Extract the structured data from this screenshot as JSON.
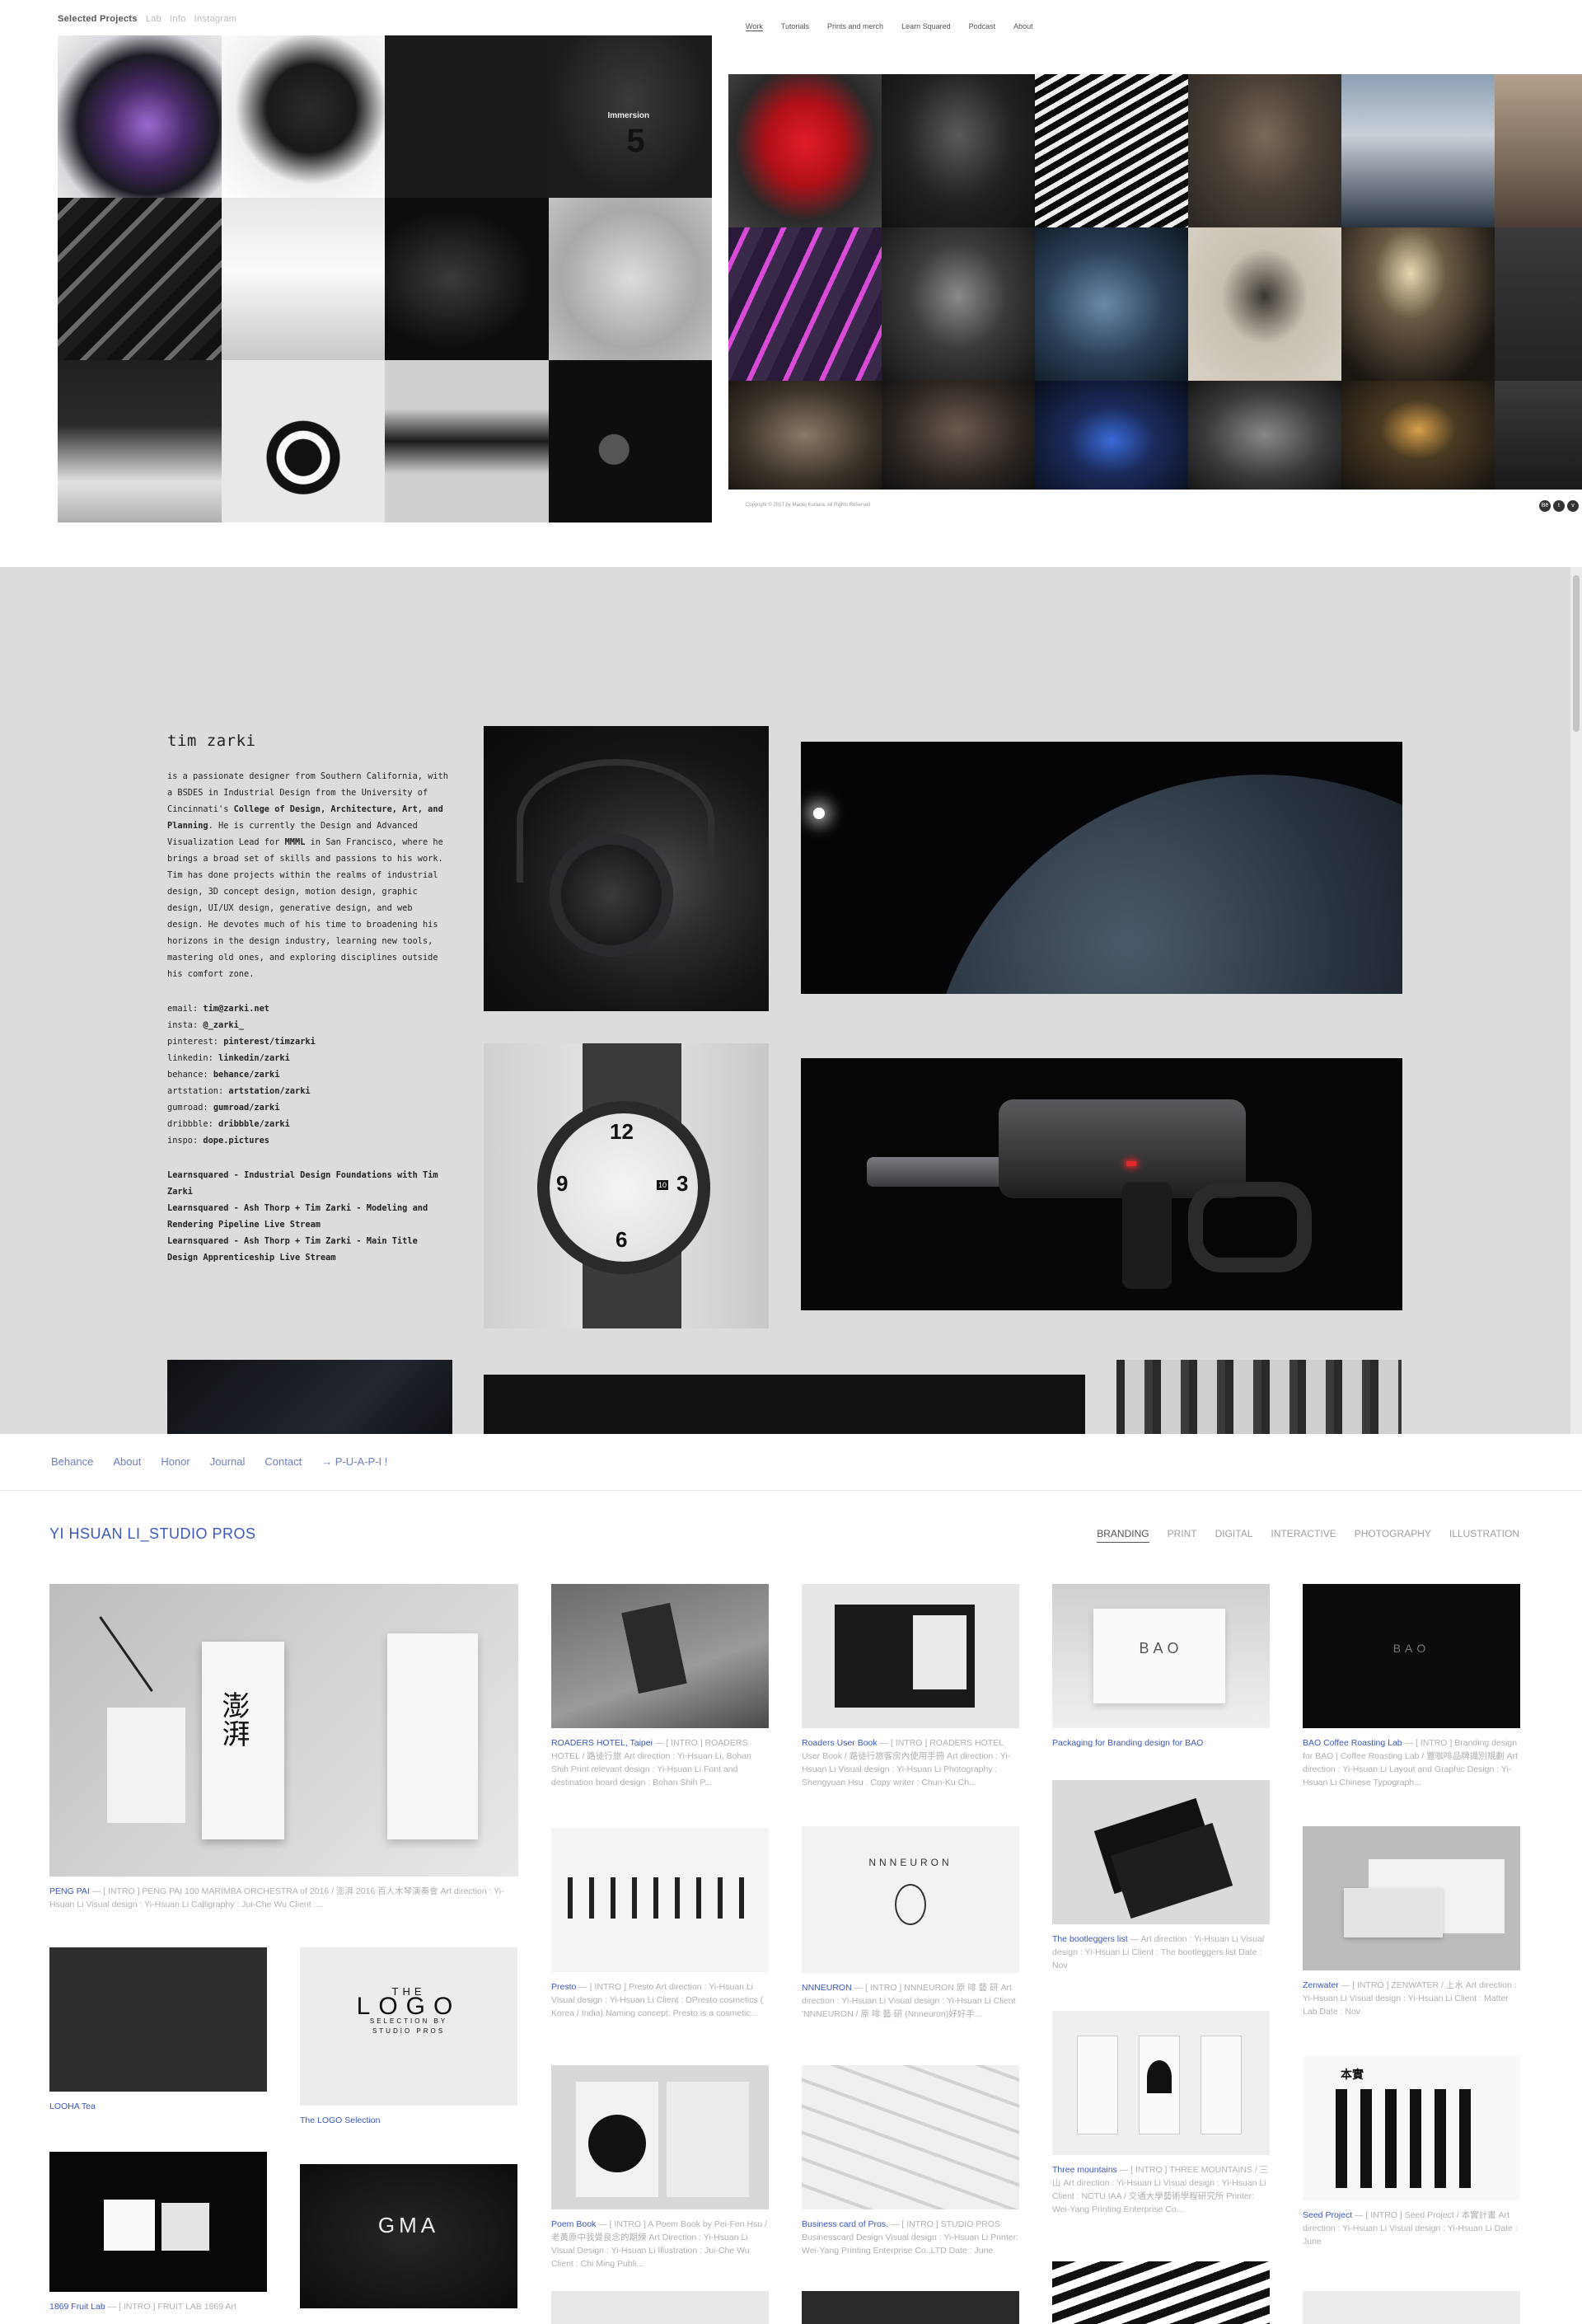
{
  "section1": {
    "nav": [
      "Selected Projects",
      "Lab",
      "Info",
      "Instagram"
    ],
    "tile_caption": "Immersion",
    "tile_number": "5",
    "top_nav": [
      "Work",
      "Tutorials",
      "Prints and merch",
      "Learn Squared",
      "Podcast",
      "About"
    ],
    "copyright": "Copyright © 2017 by Maciej Kuciara. All Rights Reserved"
  },
  "section2": {
    "name": "tim zarki",
    "bio_parts": [
      "is a passionate designer from Southern California, with a BSDES in Industrial Design from the University of Cincinnati's ",
      "College of Design, Architecture, Art, and Planning",
      ". He is currently the Design and Advanced Visualization Lead for ",
      "MMML",
      " in San Francisco, where he brings a broad set of skills and passions to his work. Tim has done projects within the realms of industrial design, 3D concept design, motion design, graphic design, UI/UX design, generative design, and web design. He devotes much of his time to broadening his horizons in the design industry, learning new tools, mastering old ones, and exploring disciplines outside his comfort zone."
    ],
    "contacts": [
      {
        "label": "email:",
        "value": "tim@zarki.net"
      },
      {
        "label": "insta:",
        "value": "@_zarki_"
      },
      {
        "label": "pinterest:",
        "value": "pinterest/timzarki"
      },
      {
        "label": "linkedin:",
        "value": "linkedin/zarki"
      },
      {
        "label": "behance:",
        "value": "behance/zarki"
      },
      {
        "label": "artstation:",
        "value": "artstation/zarki"
      },
      {
        "label": "gumroad:",
        "value": "gumroad/zarki"
      },
      {
        "label": "dribbble:",
        "value": "dribbble/zarki"
      },
      {
        "label": "inspo:",
        "value": "dope.pictures"
      }
    ],
    "classes": [
      "Learnsquared - Industrial Design Foundations with Tim Zarki",
      "Learnsquared - Ash Thorp + Tim Zarki - Modeling and Rendering Pipeline Live Stream",
      "Learnsquared - Ash Thorp + Tim Zarki - Main Title Design Apprenticeship Live Stream"
    ],
    "watch_numbers": [
      "12",
      "9",
      "3",
      "6",
      "10"
    ]
  },
  "section3": {
    "nav": [
      "Behance",
      "About",
      "Honor",
      "Journal",
      "Contact",
      "→ P-U-A-P-I !"
    ],
    "brand": "YI HSUAN LI_STUDIO PROS",
    "categories": [
      "BRANDING",
      "PRINT",
      "DIGITAL",
      "INTERACTIVE",
      "PHOTOGRAPHY",
      "ILLUSTRATION"
    ],
    "cards": [
      {
        "title": "PENG PAI",
        "desc": " — [ INTRO ] PENG PAI 100 MARIMBA ORCHESTRA of 2016 / 澎湃 2016 百人木琴演奏會 Art direction : Yi-Hsuan Li Visual design : Yi-Hsuan Li Calligraphy : Jui-Che Wu Client :..."
      },
      {
        "title": "ROADERS HOTEL, Taipei",
        "desc": " — [ INTRO ] ROADERS HOTEL / 路徒行旅 Art direction : Yi-Hsuan Li, Bohan Shih Print relevant design : Yi-Hsuan Li Font and destination board design : Bohan Shih P..."
      },
      {
        "title": "Roaders User Book",
        "desc": " — [ INTRO ] ROADERS HOTEL User Book / 路徒行旅客房內使用手冊 Art direction : Yi-Hsuan Li Visual design : Yi-Hsuan Li Photography : Shengyuan Hsu . Copy writer : Chun-Ku Ch..."
      },
      {
        "title": "Packaging for Branding design for BAO",
        "desc": ""
      },
      {
        "title": "BAO Coffee Roasting Lab",
        "desc": " — [ INTRO ] Branding design for BAO | Coffee Roasting Lab / 豐咖啡品牌識別規劃 Art direction : Yi-Hsuan Li Layout and Graphic Design : Yi-Hsuan Li Chinese Typograph..."
      },
      {
        "title": "Presto",
        "desc": " — [ INTRO ] Presto Art direction : Yi-Hsuan Li Visual design : Yi-Hsuan Li Client : DPresto cosmetics ( Korea / India) Naming concept: Presto is a cosmetic..."
      },
      {
        "title": "NNNEURON",
        "desc": " — [ INTRO ] NNNEURON 原 啡 藝 研 Art direction : Yi-Hsuan Li Visual design : Yi-Hsuan Li Client 'NNNEURON / 原 啡 藝 研 (Nnneuron)好好手..."
      },
      {
        "title": "The bootleggers list",
        "desc": " — Art direction : Yi-Hsuan Li Visual design : Yi-Hsuan Li Client : The bootleggers list Date : Nov"
      },
      {
        "title": "Zenwater",
        "desc": " — [ INTRO ] ZENWATER / 上水 Art direction : Yi-Hsuan Li Visual design : Yi-Hsuan Li Client : Matter Lab Date : Nov"
      },
      {
        "title": "LOOHA Tea",
        "desc": ""
      },
      {
        "title": "The LOGO Selection",
        "desc": ""
      },
      {
        "title": "Poem Book",
        "desc": " — [ INTRO ] A Poem Book by Pei-Fen Hsu / 老黃原中我覺良念的期練 Art Direction : Yi-Hsuan Li Visual Design : Yi-Hsuan Li Illustration : Jui-Che Wu Client : Chi Ming Publi..."
      },
      {
        "title": "Business card of Pros.",
        "desc": " — [ INTRO ] STUDIO PROS Businesscard Design Visual design : Yi-Hsuan Li Printer: Wei-Yang Printing Enterprise Co.,LTD Date : June"
      },
      {
        "title": "Three mountains",
        "desc": " — [ INTRO ] THREE MOUNTAINS / 三山 Art direction : Yi-Hsuan Li Visual design : Yi-Hsuan Li Client : NCTU IAA / 交通大學藝術學程研究所 Printer: Wei-Yang Printing Enterprise Co..."
      },
      {
        "title": "Seed Project",
        "desc": " — [ INTRO ] Seed Project / 本實計畫 Art direction : Yi-Hsuan Li Visual design : Yi-Hsuan Li Date : June"
      },
      {
        "title": "1869 Fruit Lab",
        "desc": " — [ INTRO ] FRUIT LAB 1869 Art"
      }
    ],
    "image_text": {
      "bao": "BAO",
      "bao_dark": "BAO",
      "logo_the": "THE",
      "logo_main": "LOGO",
      "logo_sub": "SELECTION BY STUDIO PROS",
      "gma": "GMA",
      "pengpai_zh": "澎湃",
      "nnneuron": "NNNEURON",
      "seed_zh": "本實"
    }
  }
}
